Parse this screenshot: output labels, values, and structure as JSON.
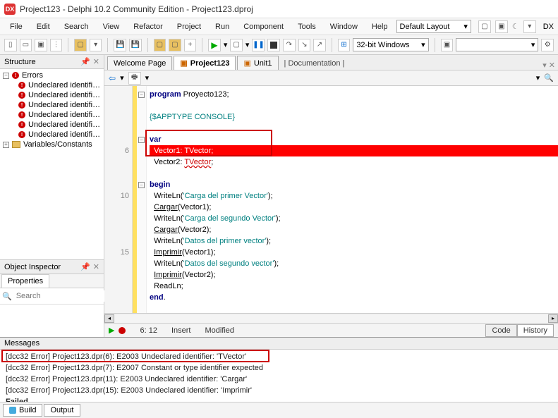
{
  "window": {
    "title": "Project123 - Delphi 10.2 Community Edition - Project123.dproj"
  },
  "menu": {
    "items": [
      "File",
      "Edit",
      "Search",
      "View",
      "Refactor",
      "Project",
      "Run",
      "Component",
      "Tools",
      "Window",
      "Help"
    ]
  },
  "layout_combo": "Default Layout",
  "platform_combo": "32-bit Windows",
  "structure": {
    "title": "Structure",
    "errors_label": "Errors",
    "error_items": [
      "Undeclared identifi…",
      "Undeclared identifi…",
      "Undeclared identifi…",
      "Undeclared identifi…",
      "Undeclared identifi…",
      "Undeclared identifi…"
    ],
    "vars_label": "Variables/Constants"
  },
  "object_inspector": {
    "title": "Object Inspector",
    "tab": "Properties",
    "search_placeholder": "Search"
  },
  "editor_tabs": {
    "welcome": "Welcome Page",
    "project": "Project123",
    "unit": "Unit1",
    "doc": "Documentation"
  },
  "code": {
    "l1": "program Proyecto123;",
    "l3": "{$APPTYPE CONSOLE}",
    "l5": "var",
    "l6a": "  Vector1: ",
    "l6b": "TVector",
    "l6c": ";",
    "l7a": "  Vector2: ",
    "l7b": "TVector",
    "l7c": ";",
    "l9": "begin",
    "l10a": "  WriteLn(",
    "l10b": "'Carga del primer Vector'",
    "l10c": ");",
    "l11": "  Cargar(Vector1);",
    "l12a": "  WriteLn(",
    "l12b": "'Carga del segundo Vector'",
    "l12c": ");",
    "l13": "  Cargar(Vector2);",
    "l14a": "  WriteLn(",
    "l14b": "'Datos del primer vector'",
    "l14c": ");",
    "l15": "  Imprimir(Vector1);",
    "l16a": "  WriteLn(",
    "l16b": "'Datos del segundo vector'",
    "l16c": ");",
    "l17": "  Imprimir(Vector2);",
    "l18": "  ReadLn;",
    "l19": "end."
  },
  "gutter": {
    "n6": "6",
    "n10": "10",
    "n15": "15"
  },
  "status": {
    "pos": "6: 12",
    "insert": "Insert",
    "modified": "Modified",
    "tab_code": "Code",
    "tab_history": "History"
  },
  "messages": {
    "title": "Messages",
    "lines": [
      "[dcc32 Error] Project123.dpr(6): E2003 Undeclared identifier: 'TVector'",
      "[dcc32 Error] Project123.dpr(7): E2007 Constant or type identifier expected",
      "[dcc32 Error] Project123.dpr(11): E2003 Undeclared identifier: 'Cargar'",
      "[dcc32 Error] Project123.dpr(15): E2003 Undeclared identifier: 'Imprimir'"
    ],
    "failed": "Failed",
    "tab_build": "Build",
    "tab_output": "Output"
  }
}
